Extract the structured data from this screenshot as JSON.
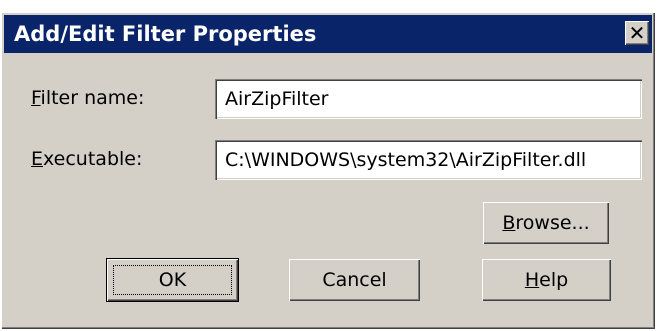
{
  "window": {
    "title": "Add/Edit Filter Properties",
    "close_glyph": "✕"
  },
  "form": {
    "filter_name": {
      "label_mnemonic": "F",
      "label_rest": "ilter name:",
      "value": "AirZipFilter"
    },
    "executable": {
      "label_mnemonic": "E",
      "label_rest": "xecutable:",
      "value": "C:\\WINDOWS\\system32\\AirZipFilter.dll"
    }
  },
  "buttons": {
    "browse": {
      "mnemonic": "B",
      "rest": "rowse..."
    },
    "ok": {
      "label": "OK"
    },
    "cancel": {
      "label": "Cancel"
    },
    "help": {
      "mnemonic": "H",
      "rest": "elp"
    }
  },
  "colors": {
    "titlebar": "#0a246a",
    "dialog_face": "#d4d0c8"
  }
}
